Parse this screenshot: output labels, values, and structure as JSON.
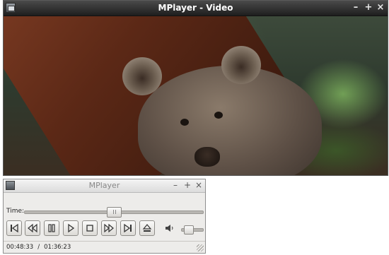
{
  "video_window": {
    "title": "MPlayer - Video",
    "controls": {
      "minimize": "–",
      "maximize": "+",
      "close": "×"
    },
    "icon": "mplayer-app-icon"
  },
  "control_window": {
    "title": "MPlayer",
    "controls": {
      "minimize": "–",
      "maximize": "+",
      "close": "×"
    },
    "icon": "mplayer-app-icon",
    "time_label": "Time:",
    "seek_position": 0.5,
    "volume_level": 0.3,
    "buttons": [
      {
        "name": "skip-back-button",
        "icon": "skip-to-start-icon"
      },
      {
        "name": "rewind-button",
        "icon": "rewind-icon"
      },
      {
        "name": "pause-button",
        "icon": "pause-icon"
      },
      {
        "name": "play-button",
        "icon": "play-icon"
      },
      {
        "name": "stop-button",
        "icon": "stop-icon"
      },
      {
        "name": "fast-forward-button",
        "icon": "fast-forward-icon"
      },
      {
        "name": "skip-forward-button",
        "icon": "skip-to-end-icon"
      },
      {
        "name": "eject-button",
        "icon": "eject-icon"
      }
    ],
    "status": {
      "elapsed": "00:48:33",
      "separator": "/",
      "total": "01:36:23"
    }
  },
  "colors": {
    "dark_titlebar": "#2e2e2e",
    "light_window": "#edecea",
    "title_text_dark": "#ffffff",
    "title_text_light": "#888888"
  }
}
